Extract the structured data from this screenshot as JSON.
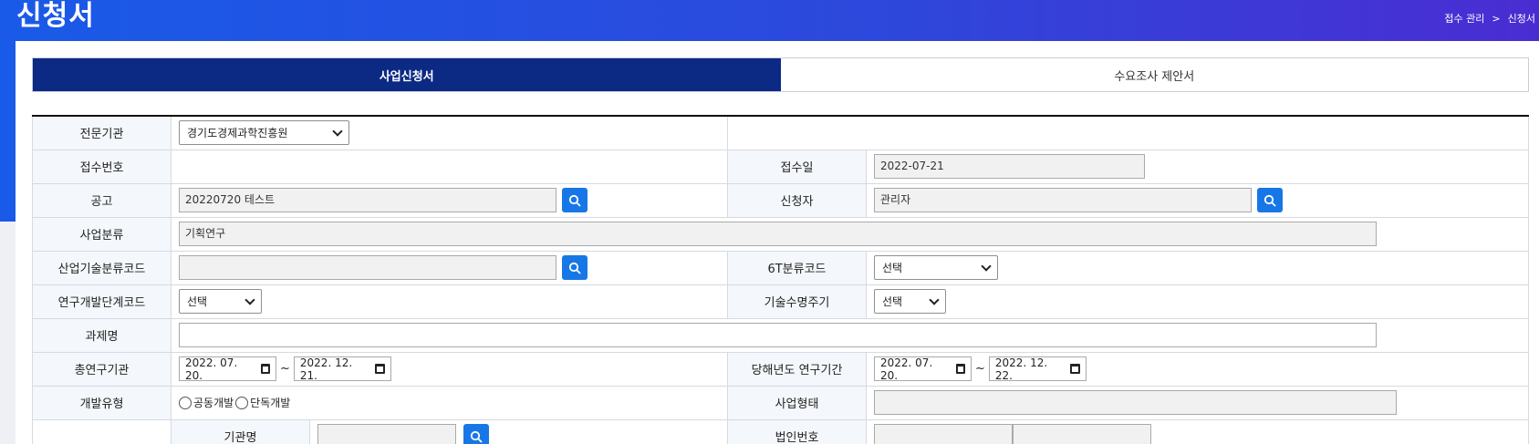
{
  "page": {
    "title": "신청서"
  },
  "breadcrumb": {
    "parent": "접수 관리",
    "separator": ">",
    "current": "신청서"
  },
  "tabs": [
    {
      "label": "사업신청서",
      "active": true
    },
    {
      "label": "수요조사 제안서",
      "active": false
    }
  ],
  "form": {
    "agency": {
      "label": "전문기관",
      "value": "경기도경제과학진흥원"
    },
    "receipt_no": {
      "label": "접수번호",
      "value": ""
    },
    "receipt_date": {
      "label": "접수일",
      "value": "2022-07-21"
    },
    "notice": {
      "label": "공고",
      "value": "20220720 테스트"
    },
    "applicant": {
      "label": "신청자",
      "value": "관리자"
    },
    "business_class": {
      "label": "사업분류",
      "value": "기획연구"
    },
    "industry_code": {
      "label": "산업기술분류코드",
      "value": ""
    },
    "six_t_code": {
      "label": "6T분류코드",
      "value": "선택"
    },
    "rnd_stage_code": {
      "label": "연구개발단계코드",
      "value": "선택"
    },
    "tech_lifecycle": {
      "label": "기술수명주기",
      "value": "선택"
    },
    "project_name": {
      "label": "과제명",
      "value": ""
    },
    "total_period": {
      "label": "총연구기관",
      "start": "2022. 07. 20.",
      "end": "2022. 12. 21."
    },
    "year_period": {
      "label": "당해년도 연구기간",
      "start": "2022. 07. 20.",
      "end": "2022. 12. 22."
    },
    "dev_type": {
      "label": "개발유형",
      "options": [
        "공동개발",
        "단독개발"
      ]
    },
    "business_type": {
      "label": "사업형태",
      "value": ""
    },
    "org_name": {
      "label": "기관명",
      "value": ""
    },
    "corp_no": {
      "label": "법인번호",
      "value": ""
    }
  },
  "date_separator": "~",
  "colors": {
    "active_tab": "#0c2a84",
    "search_button": "#1877e6",
    "header_gradient_start": "#1a5ae8",
    "header_gradient_end": "#4a2dd2"
  }
}
